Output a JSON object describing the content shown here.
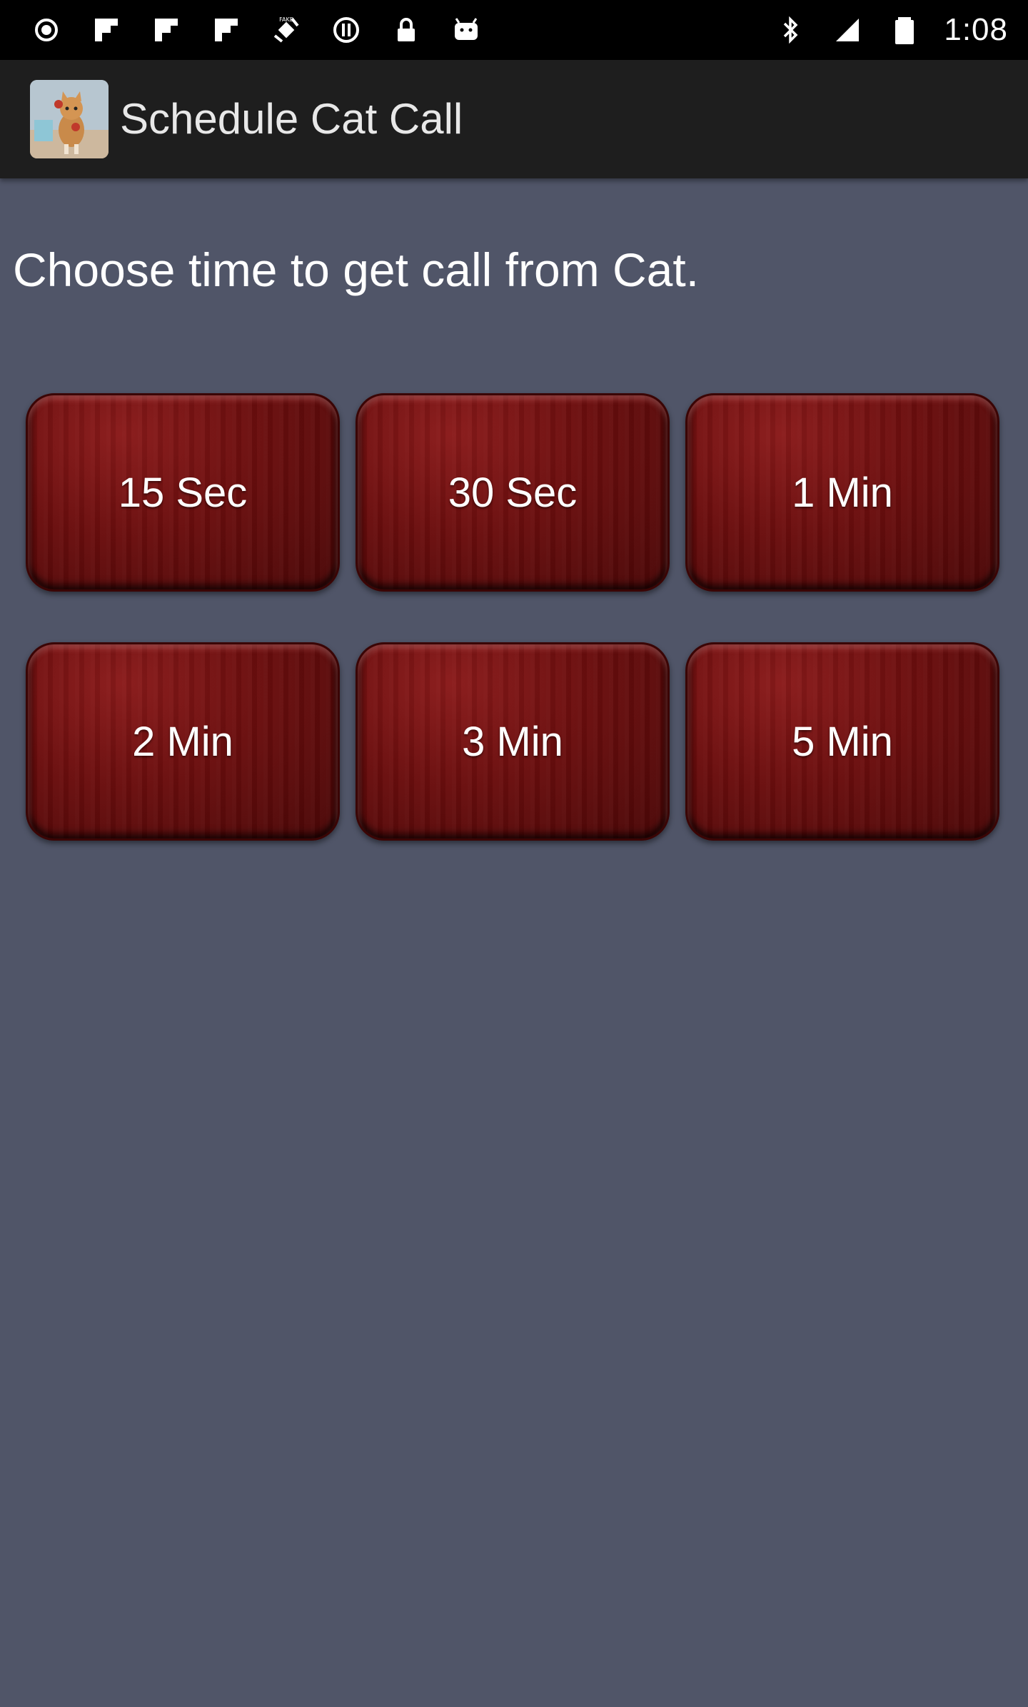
{
  "status_bar": {
    "time": "1:08",
    "left_icons": [
      "record-icon",
      "flipboard-icon",
      "flipboard-icon",
      "flipboard-icon",
      "fake-gps-icon",
      "pause-icon",
      "lock-icon",
      "android-icon"
    ],
    "right_icons": [
      "bluetooth-icon",
      "signal-icon",
      "battery-icon"
    ]
  },
  "action_bar": {
    "title": "Schedule Cat Call",
    "logo_icon": "cat-app-logo"
  },
  "main": {
    "prompt": "Choose time to get call from Cat.",
    "buttons": [
      {
        "label": "15 Sec"
      },
      {
        "label": "30 Sec"
      },
      {
        "label": "1 Min"
      },
      {
        "label": "2 Min"
      },
      {
        "label": "3 Min"
      },
      {
        "label": "5 Min"
      }
    ]
  },
  "colors": {
    "background": "#505568",
    "action_bar": "#1e1e1e",
    "status_bar": "#000000",
    "button": "#6b0e0e",
    "text": "#ffffff"
  }
}
